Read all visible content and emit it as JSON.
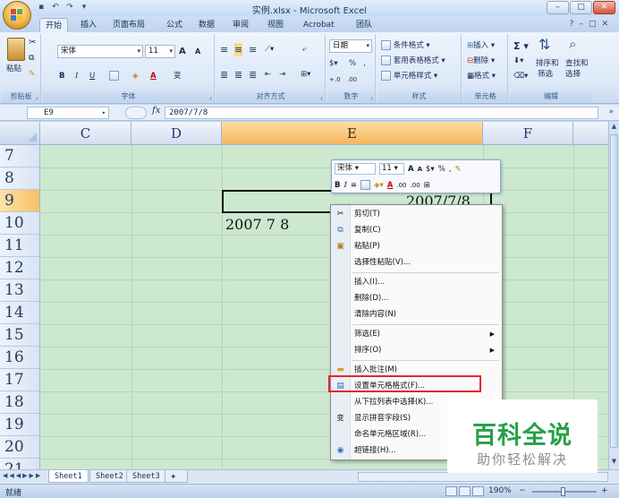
{
  "window": {
    "title": "实例.xlsx - Microsoft Excel"
  },
  "ribbon_tabs": [
    "开始",
    "插入",
    "页面布局",
    "公式",
    "数据",
    "审阅",
    "视图",
    "Acrobat",
    "团队"
  ],
  "ribbon": {
    "clipboard": {
      "paste": "粘贴",
      "label": "剪贴板"
    },
    "font": {
      "name": "宋体",
      "size": "11",
      "bold": "B",
      "italic": "I",
      "underline": "U",
      "grow": "A",
      "shrink": "A",
      "color_a": "A",
      "wen": "变",
      "label": "字体"
    },
    "alignment": {
      "label": "对齐方式"
    },
    "number": {
      "format": "日期",
      "percent": "%",
      "comma": ",",
      "label": "数字"
    },
    "styles": {
      "conditional": "条件格式",
      "table": "套用表格格式",
      "cell": "单元格样式",
      "label": "样式"
    },
    "cells": {
      "insert": "插入",
      "delete": "删除",
      "format": "格式",
      "label": "单元格"
    },
    "editing": {
      "sigma": "Σ",
      "sort": "排序和",
      "sort2": "筛选",
      "find": "查找和",
      "find2": "选择",
      "label": "编辑"
    }
  },
  "formula_bar": {
    "name_box": "E9",
    "fx": "fx",
    "value": "2007/7/8"
  },
  "columns": [
    "C",
    "D",
    "E",
    "F"
  ],
  "rows": [
    "7",
    "8",
    "9",
    "10",
    "11",
    "12",
    "13",
    "14",
    "15",
    "16",
    "17",
    "18",
    "19",
    "20",
    "21"
  ],
  "cells": {
    "E9": "2007/7/8",
    "D10": "2007 7 8"
  },
  "mini_toolbar": {
    "font": "宋体",
    "size": "11",
    "grow": "A",
    "shrink": "A",
    "percent": "%",
    "comma": ",",
    "bold": "B",
    "italic": "I",
    "align": "≡",
    "color_a": "A",
    "inc": ".00",
    "dec": ".00"
  },
  "context_menu": [
    {
      "label": "剪切(T)",
      "icon": "scissors-icon"
    },
    {
      "label": "复制(C)",
      "icon": "copy-icon"
    },
    {
      "label": "粘贴(P)",
      "icon": "paste-icon"
    },
    {
      "label": "选择性粘贴(V)..."
    },
    {
      "label": "插入(I)..."
    },
    {
      "label": "删除(D)..."
    },
    {
      "label": "清除内容(N)"
    },
    {
      "label": "筛选(E)",
      "submenu": true
    },
    {
      "label": "排序(O)",
      "submenu": true
    },
    {
      "label": "插入批注(M)",
      "icon": "comment-icon"
    },
    {
      "label": "设置单元格格式(F)...",
      "icon": "format-cells-icon",
      "highlighted": true
    },
    {
      "label": "从下拉列表中选择(K)..."
    },
    {
      "label": "显示拼音字段(S)",
      "icon": "phonetic-icon"
    },
    {
      "label": "命名单元格区域(R)..."
    },
    {
      "label": "超链接(H)...",
      "icon": "hyperlink-icon"
    }
  ],
  "sheets": [
    "Sheet1",
    "Sheet2",
    "Sheet3"
  ],
  "status": {
    "ready": "就绪",
    "zoom": "190%",
    "zoom_out": "−",
    "zoom_in": "+"
  },
  "watermark": {
    "big": "百科全说",
    "small": "助你轻松解决"
  },
  "colors": {
    "accent": "#f6b760",
    "grid_bg": "#cce8cf",
    "highlight_border": "#e0292b",
    "watermark_green": "#27a048"
  }
}
